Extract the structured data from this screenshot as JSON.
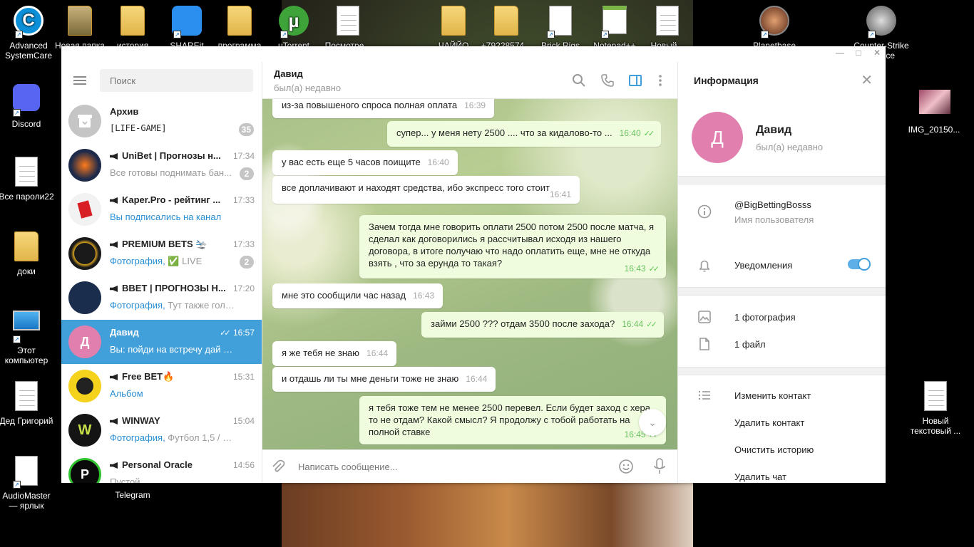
{
  "desktop": {
    "icons_left": [
      {
        "label": "Advanced SystemCare"
      },
      {
        "label": "Discord"
      },
      {
        "label": "Все пароли22"
      },
      {
        "label": "доки"
      },
      {
        "label": "Этот компьютер"
      },
      {
        "label": "Дед Григорий"
      },
      {
        "label": "AudioMaster — ярлык"
      }
    ],
    "icons_top": [
      {
        "label": "Новая папка"
      },
      {
        "label": "история"
      },
      {
        "label": "SHAREit"
      },
      {
        "label": "программа"
      },
      {
        "label": "uTorrent"
      },
      {
        "label": "Посмотре..."
      },
      {
        "label": "ЧАЙЙО"
      },
      {
        "label": "+79228574..."
      },
      {
        "label": "Brick Rigs"
      },
      {
        "label": "Notepad++"
      },
      {
        "label": "Новый..."
      }
    ],
    "icons_right": [
      {
        "label": "Planetbase"
      },
      {
        "label": "Counter-Strike Source"
      },
      {
        "label": "IMG_20150..."
      },
      {
        "label": "Новый текстовый ..."
      }
    ],
    "taskbar_label": "Telegram"
  },
  "window": {
    "controls": [
      "—",
      "□",
      "✕"
    ]
  },
  "sidebar": {
    "search_placeholder": "Поиск",
    "chats": [
      {
        "name": "Архив",
        "preview": "[LIFE-GAME]",
        "time": "",
        "badge": "35",
        "avatar_color": "#c5c5c5",
        "channel": false
      },
      {
        "name": "UniBet | Прогнозы н...",
        "preview": "Все готовы поднимать бан...",
        "time": "17:34",
        "badge": "2",
        "avatar_color": "#1e2a4a",
        "channel": true
      },
      {
        "name": "Kaper.Pro - рейтинг ...",
        "preview_hl": "Вы подписались на канал",
        "time": "17:33",
        "badge": "",
        "avatar_color": "#f2f2f2",
        "channel": true
      },
      {
        "name": "PREMIUM BETS 🛬",
        "preview_hl": "Фотография, ",
        "preview": "✅ LIVE",
        "time": "17:33",
        "badge": "2",
        "avatar_color": "#1a1a1a",
        "channel": true
      },
      {
        "name": "BBET | ПРОГНОЗЫ Н...",
        "preview_hl": "Фотография, ",
        "preview": "Тут также гол, с п...",
        "time": "17:20",
        "badge": "",
        "avatar_color": "#1b2d4d",
        "channel": true
      },
      {
        "name": "Давид",
        "avatar_letter": "Д",
        "preview": "Вы: пойди на встречу дай 3 соб...",
        "time": "16:57",
        "badge": "",
        "avatar_color": "#e17fae",
        "channel": false,
        "active": true
      },
      {
        "name": "Free BET🔥",
        "preview_hl": "Альбом",
        "time": "15:31",
        "badge": "",
        "avatar_color": "#f5d21c",
        "channel": true
      },
      {
        "name": "WINWAY",
        "preview_hl": "Фотография, ",
        "preview": "Футбол 1,5 / 2 Тр...",
        "time": "15:04",
        "badge": "",
        "avatar_color": "#141414",
        "channel": true
      },
      {
        "name": "Personal Oracle",
        "preview": "Пустой ...",
        "time": "14:56",
        "badge": "",
        "avatar_color": "#0a0a0a",
        "channel": true
      }
    ]
  },
  "chat": {
    "peer_name": "Давид",
    "peer_status": "был(а) недавно",
    "composer_placeholder": "Написать сообщение...",
    "messages": [
      {
        "dir": "in",
        "text": "из-за повышеного спроса полная оплата",
        "time": "16:39"
      },
      {
        "dir": "out",
        "text": "супер... у меня нету 2500 .... что за кидалово-то ...",
        "time": "16:40"
      },
      {
        "dir": "in",
        "text": "у вас есть еще 5 часов поищите",
        "time": "16:40"
      },
      {
        "dir": "in",
        "text": "все доплачивают и находят средства, ибо экспресс того стоит",
        "time": "16:41"
      },
      {
        "dir": "out",
        "text": "Зачем тогда мне говорить оплати 2500 потом 2500 после матча, я сделал как договорились я рассчитывал исходя из нашего договора, в итоге получаю что надо оплатить еще, мне не откуда взять , что за ерунда то такая?",
        "time": "16:43"
      },
      {
        "dir": "in",
        "text": "мне это сообщили час назад",
        "time": "16:43"
      },
      {
        "dir": "out",
        "text": "займи 2500 ??? отдам 3500 после захода?",
        "time": "16:44"
      },
      {
        "dir": "in",
        "text": "я же тебя не знаю",
        "time": "16:44"
      },
      {
        "dir": "in",
        "text": "и отдашь ли ты мне деньги тоже не знаю",
        "time": "16:44"
      },
      {
        "dir": "out",
        "text": "я тебя тоже тем не менее 2500 перевел. Если будет заход с хера то не отдам? Какой смысл? Я продолжу с тобой работать на полной ставке",
        "time": "16:45"
      }
    ]
  },
  "info": {
    "title": "Информация",
    "avatar_letter": "Д",
    "name": "Давид",
    "status": "был(а) недавно",
    "username": "@BigBettingBosss",
    "username_label": "Имя пользователя",
    "notifications_label": "Уведомления",
    "notifications_on": true,
    "photos": "1 фотография",
    "files": "1 файл",
    "actions": [
      "Изменить контакт",
      "Удалить контакт",
      "Очистить историю",
      "Удалить чат"
    ]
  },
  "colors": {
    "accent": "#419fd9",
    "out_bubble": "#effdde",
    "in_bubble": "#ffffff",
    "check": "#5dc452"
  }
}
